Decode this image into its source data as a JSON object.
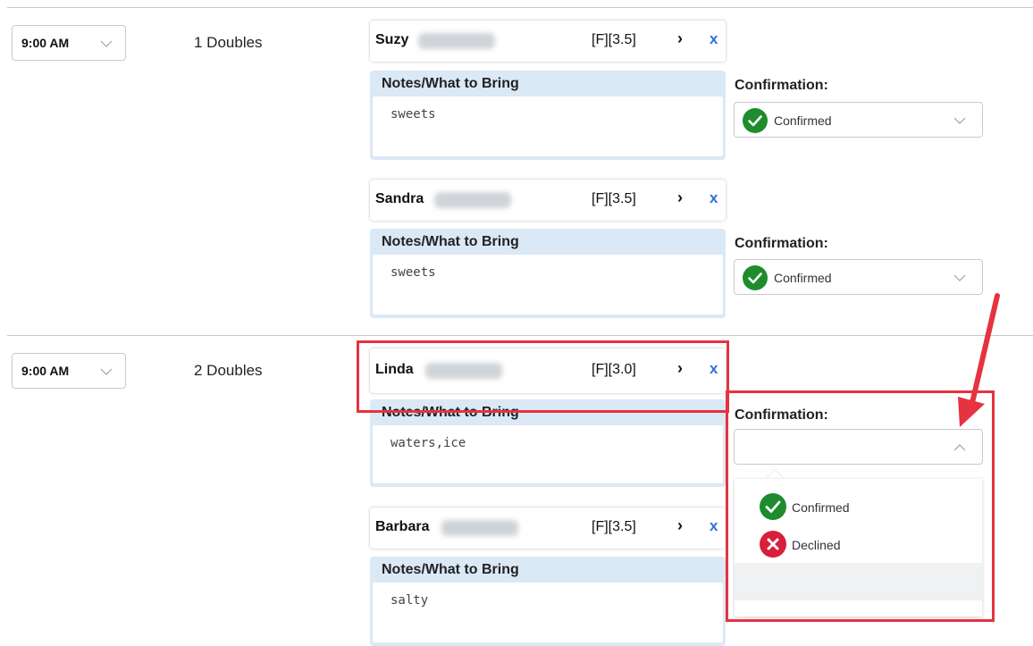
{
  "groups": [
    {
      "time": "9:00 AM",
      "court": "1 Doubles",
      "players": [
        {
          "first_name": "Suzy",
          "rating": "[F][3.5]",
          "notes_label": "Notes/What to Bring",
          "notes": "sweets",
          "confirmation_label": "Confirmation:",
          "confirmation": "Confirmed"
        },
        {
          "first_name": "Sandra",
          "rating": "[F][3.5]",
          "notes_label": "Notes/What to Bring",
          "notes": "sweets",
          "confirmation_label": "Confirmation:",
          "confirmation": "Confirmed"
        }
      ]
    },
    {
      "time": "9:00 AM",
      "court": "2 Doubles",
      "players": [
        {
          "first_name": "Linda",
          "rating": "[F][3.0]",
          "notes_label": "Notes/What to Bring",
          "notes": "waters,ice",
          "confirmation_label": "Confirmation:",
          "confirmation": ""
        },
        {
          "first_name": "Barbara",
          "rating": "[F][3.5]",
          "notes_label": "Notes/What to Bring",
          "notes": "salty"
        }
      ]
    }
  ],
  "icons": {
    "detail": "›",
    "remove": "x"
  },
  "dropdown_options": [
    "Confirmed",
    "Declined"
  ],
  "colors": {
    "confirmed": "#1e8c2e",
    "declined": "#d81f3c",
    "remove_link": "#2e6fd6",
    "highlight": "#e5333f"
  }
}
